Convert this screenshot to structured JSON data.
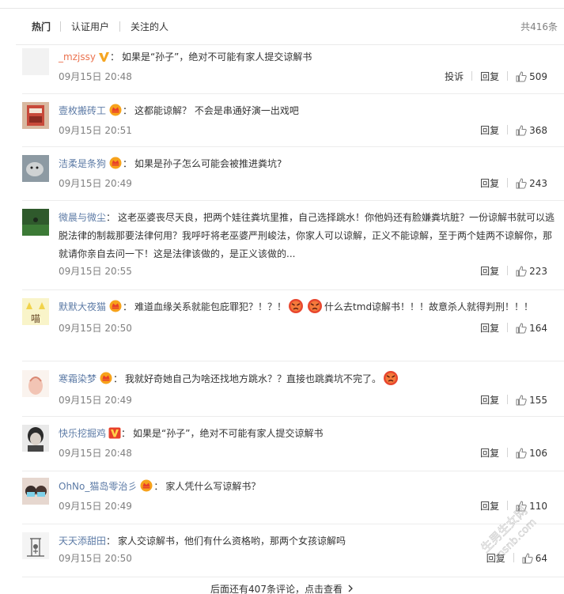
{
  "tabs": [
    {
      "label": "热门"
    },
    {
      "label": "认证用户"
    },
    {
      "label": "关注的人"
    }
  ],
  "total_label": "共416条",
  "actions": {
    "report": "投诉",
    "reply": "回复"
  },
  "comments": [
    {
      "username": "_mzjssy",
      "badge": "v-gold",
      "text": "如果是“孙子”，绝对不可能有家人提交谅解书",
      "time": "09月15日 20:48",
      "likes": "509",
      "report": true
    },
    {
      "username": "壹枚搬砖工",
      "badge": "crown",
      "text": "这都能谅解？ 不会是串通好演一出戏吧",
      "time": "09月15日 20:51",
      "likes": "368"
    },
    {
      "username": "洁柔是条狗",
      "badge": "crown",
      "text": "如果是孙子怎么可能会被推进粪坑?",
      "time": "09月15日 20:49",
      "likes": "243"
    },
    {
      "username": "微晨与微尘",
      "badge": "",
      "text": "这老巫婆丧尽天良，把两个娃往粪坑里推，自己选择跳水！你他妈还有脸嫌粪坑脏？一份谅解书就可以逃脱法律的制裁那要法律何用？我呼吁将老巫婆严刑峻法，你家人可以谅解，正义不能谅解，至于两个娃两不谅解你，那就请你亲自去问一下！这是法律该做的，是正义该做的...",
      "time": "09月15日 20:55",
      "likes": "223"
    },
    {
      "username": "默默大夜猫",
      "badge": "crown",
      "text_a": "难道血缘关系就能包庇罪犯？！？！",
      "text_b": "什么去tmd谅解书！！！故意杀人就得判刑！！！",
      "time": "09月15日 20:50",
      "likes": "164"
    },
    {
      "username": "寒霜染梦",
      "badge": "crown",
      "text": "我就好奇她自己为啥还找地方跳水？？直接也跳粪坑不完了。",
      "time": "09月15日 20:49",
      "likes": "155"
    },
    {
      "username": "快乐挖掘鸡",
      "badge": "v-red",
      "text": "如果是“孙子”，绝对不可能有家人提交谅解书",
      "time": "09月15日 20:48",
      "likes": "106"
    },
    {
      "username": "OhNo_猫岛零治彡",
      "badge": "crown",
      "text": "家人凭什么写谅解书？",
      "time": "09月15日 20:49",
      "likes": "110"
    },
    {
      "username": "天天添甜田",
      "badge": "",
      "text": "家人交谅解书，他们有什么资格哟，那两个女孩谅解吗",
      "time": "09月15日 20:50",
      "likes": "64"
    }
  ],
  "more_comments": "后面还有407条评论，点击查看",
  "watermark": {
    "text": "生男生女网",
    "url": "snsnb.com"
  },
  "colors": {
    "username": "#eb7350",
    "link_blue": "#5d7ba6",
    "meta": "#808080"
  }
}
